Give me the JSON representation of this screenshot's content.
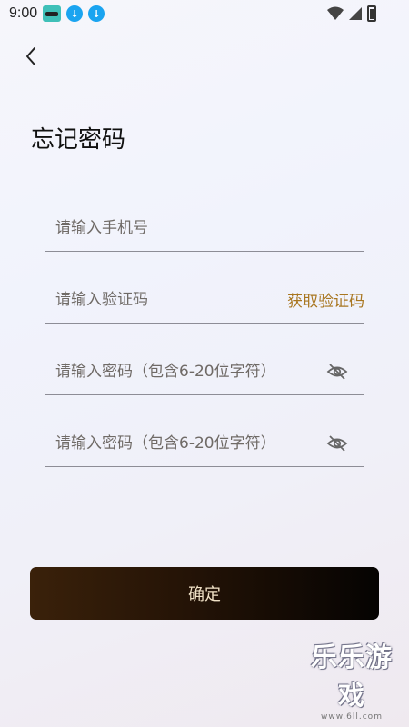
{
  "status_bar": {
    "time": "9:00",
    "icons": [
      "app-icon",
      "download-icon",
      "download-icon",
      "wifi-icon",
      "signal-icon",
      "battery-icon"
    ]
  },
  "header": {
    "back_icon": "chevron-left-icon",
    "title": "忘记密码"
  },
  "form": {
    "phone": {
      "placeholder": "请输入手机号",
      "value": ""
    },
    "code": {
      "placeholder": "请输入验证码",
      "value": "",
      "action_label": "获取验证码"
    },
    "password": {
      "placeholder": "请输入密码（包含6-20位字符）",
      "value": "",
      "toggle_icon": "eye-off-icon"
    },
    "confirm_password": {
      "placeholder": "请输入密码（包含6-20位字符）",
      "value": "",
      "toggle_icon": "eye-off-icon"
    },
    "submit_label": "确定"
  },
  "watermark": {
    "brand": "乐乐游戏",
    "url": "www.6ll.com"
  },
  "colors": {
    "accent": "#a8761f",
    "button_start": "#3a210a",
    "button_end": "#050302",
    "button_text": "#f0e1c6"
  }
}
